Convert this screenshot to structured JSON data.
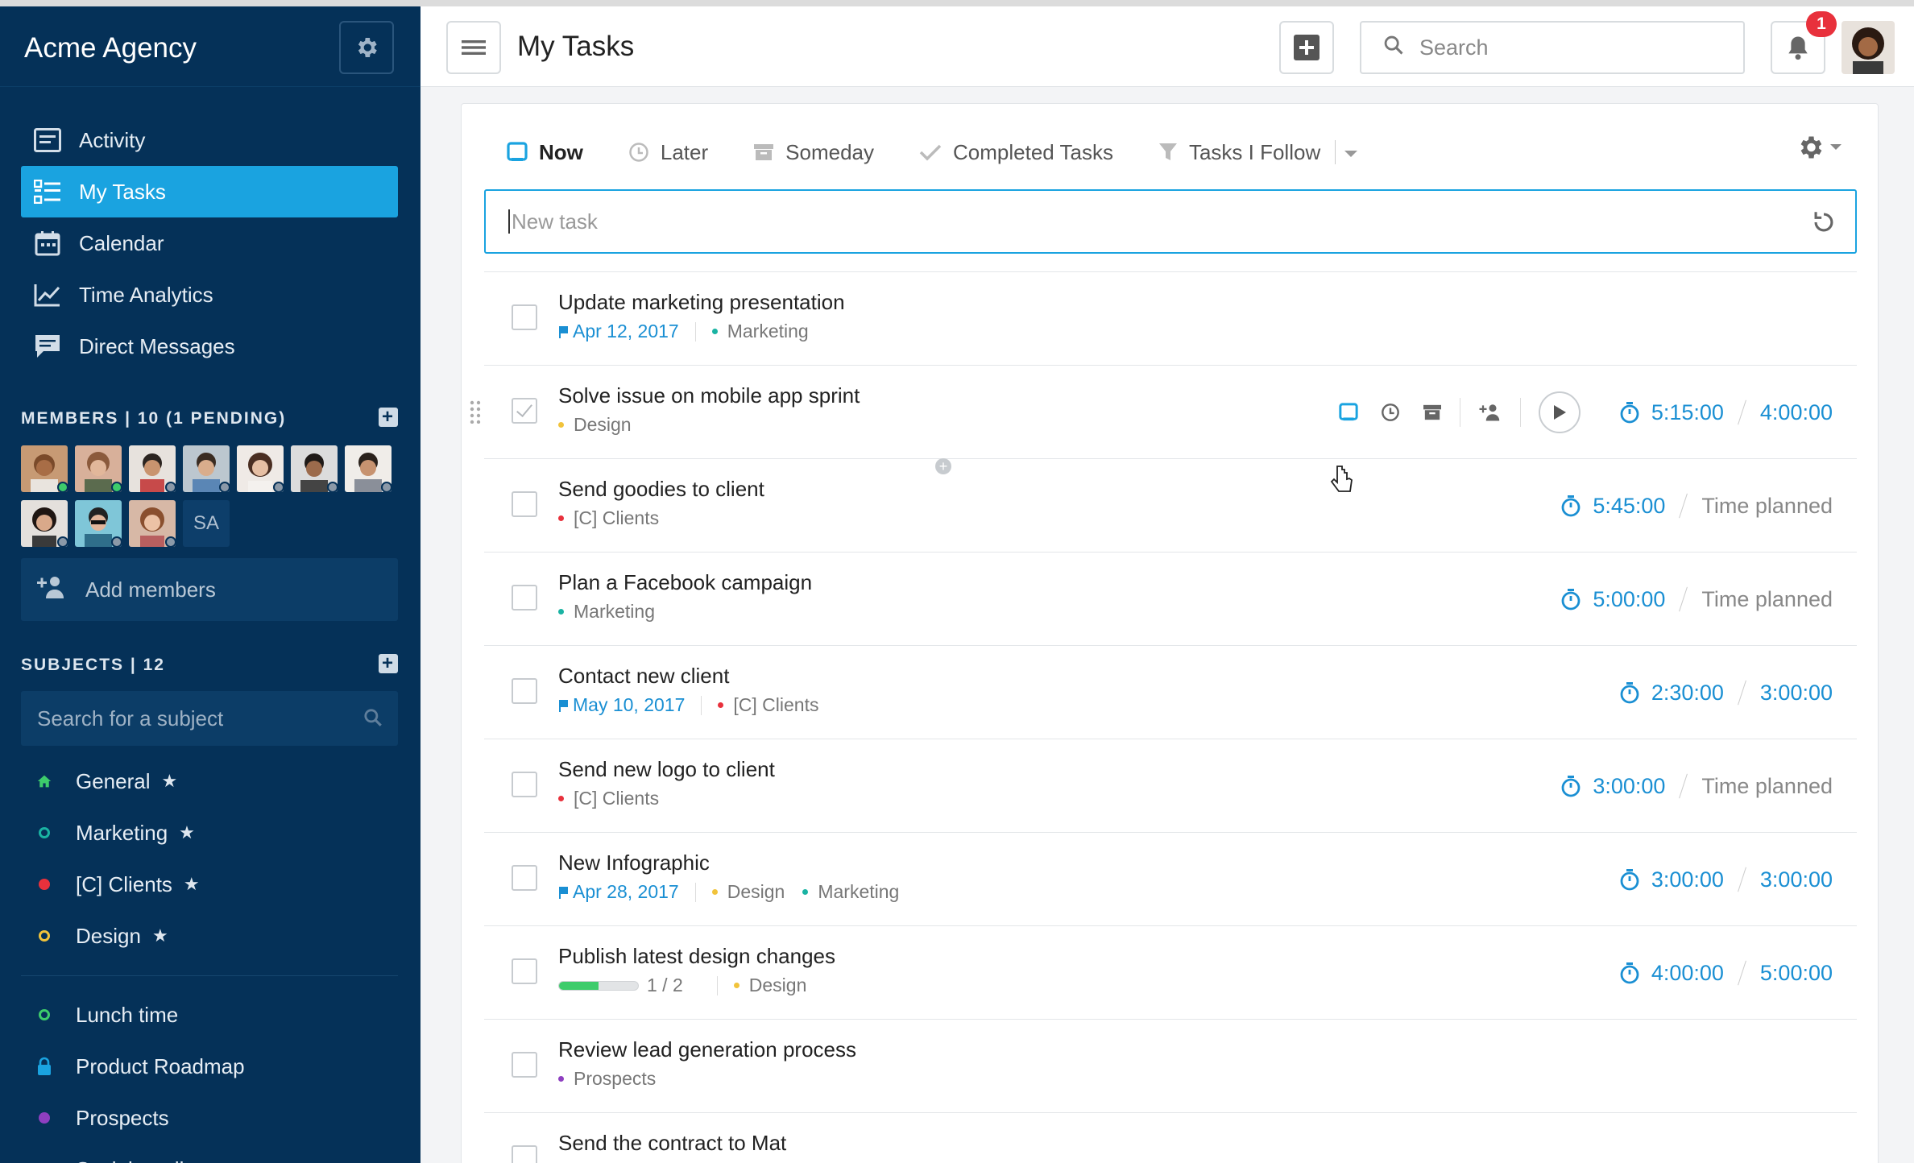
{
  "sidebar": {
    "org_name": "Acme Agency",
    "nav": [
      {
        "label": "Activity",
        "icon": "activity-icon"
      },
      {
        "label": "My Tasks",
        "icon": "tasks-icon",
        "active": true
      },
      {
        "label": "Calendar",
        "icon": "calendar-icon"
      },
      {
        "label": "Time Analytics",
        "icon": "analytics-icon"
      },
      {
        "label": "Direct Messages",
        "icon": "messages-icon"
      }
    ],
    "members_header": "MEMBERS | 10 (1 PENDING)",
    "member_initials": "SA",
    "add_members_label": "Add members",
    "subjects_header": "SUBJECTS | 12",
    "subject_search_placeholder": "Search for a subject",
    "subjects": [
      {
        "label": "General",
        "color": "#3dcc6b",
        "icon": "home-icon",
        "star": "★"
      },
      {
        "label": "Marketing",
        "color": "#1ab3a3",
        "icon": "ring-icon",
        "star": "★"
      },
      {
        "label": "[C] Clients",
        "color": "#e8313c",
        "icon": "dot-icon",
        "star": "★"
      },
      {
        "label": "Design",
        "color": "#f1c33b",
        "icon": "ring-icon",
        "star": "★"
      }
    ],
    "subjects2": [
      {
        "label": "Lunch time",
        "color": "#3dcc6b",
        "icon": "ring-icon"
      },
      {
        "label": "Product Roadmap",
        "color": "#1aa3e0",
        "icon": "lock-icon"
      },
      {
        "label": "Prospects",
        "color": "#8e3fc0",
        "icon": "dot-icon"
      },
      {
        "label": "Social media",
        "color": "#888888",
        "icon": "dot-icon"
      }
    ]
  },
  "topbar": {
    "title": "My Tasks",
    "search_placeholder": "Search",
    "notification_count": "1"
  },
  "tabs": [
    {
      "label": "Now",
      "active": true
    },
    {
      "label": "Later"
    },
    {
      "label": "Someday"
    },
    {
      "label": "Completed Tasks"
    },
    {
      "label": "Tasks I Follow"
    }
  ],
  "new_task_placeholder": "New task",
  "tasks": [
    {
      "title": "Update marketing presentation",
      "date": "Apr 12, 2017",
      "tags": [
        {
          "name": "Marketing",
          "color": "#1ab3a3"
        }
      ]
    },
    {
      "title": "Solve issue on mobile app sprint",
      "tags": [
        {
          "name": "Design",
          "color": "#f1c33b"
        }
      ],
      "tracked": "5:15:00",
      "planned": "4:00:00",
      "checked": true,
      "hover": true
    },
    {
      "title": "Send goodies to client",
      "tags": [
        {
          "name": "[C] Clients",
          "color": "#e8313c"
        }
      ],
      "tracked": "5:45:00",
      "planned": "Time planned",
      "muted": true
    },
    {
      "title": "Plan a Facebook campaign",
      "tags": [
        {
          "name": "Marketing",
          "color": "#1ab3a3"
        }
      ],
      "tracked": "5:00:00",
      "planned": "Time planned",
      "muted": true
    },
    {
      "title": "Contact new client",
      "date": "May 10, 2017",
      "tags": [
        {
          "name": "[C] Clients",
          "color": "#e8313c"
        }
      ],
      "tracked": "2:30:00",
      "planned": "3:00:00"
    },
    {
      "title": "Send new logo to client",
      "tags": [
        {
          "name": "[C] Clients",
          "color": "#e8313c"
        }
      ],
      "tracked": "3:00:00",
      "planned": "Time planned",
      "muted": true
    },
    {
      "title": "New Infographic",
      "date": "Apr 28, 2017",
      "tags": [
        {
          "name": "Design",
          "color": "#f1c33b"
        },
        {
          "name": "Marketing",
          "color": "#1ab3a3"
        }
      ],
      "tracked": "3:00:00",
      "planned": "3:00:00"
    },
    {
      "title": "Publish latest design changes",
      "progress": "1 / 2",
      "progress_fraction": 0.5,
      "tags": [
        {
          "name": "Design",
          "color": "#f1c33b"
        }
      ],
      "tracked": "4:00:00",
      "planned": "5:00:00"
    },
    {
      "title": "Review lead generation process",
      "tags": [
        {
          "name": "Prospects",
          "color": "#8e3fc0"
        }
      ]
    },
    {
      "title": "Send the contract to Mat",
      "tags": []
    }
  ],
  "colors": {
    "accent": "#1aa3e0",
    "sidebar_bg": "#053158",
    "link": "#1a8fd3"
  }
}
